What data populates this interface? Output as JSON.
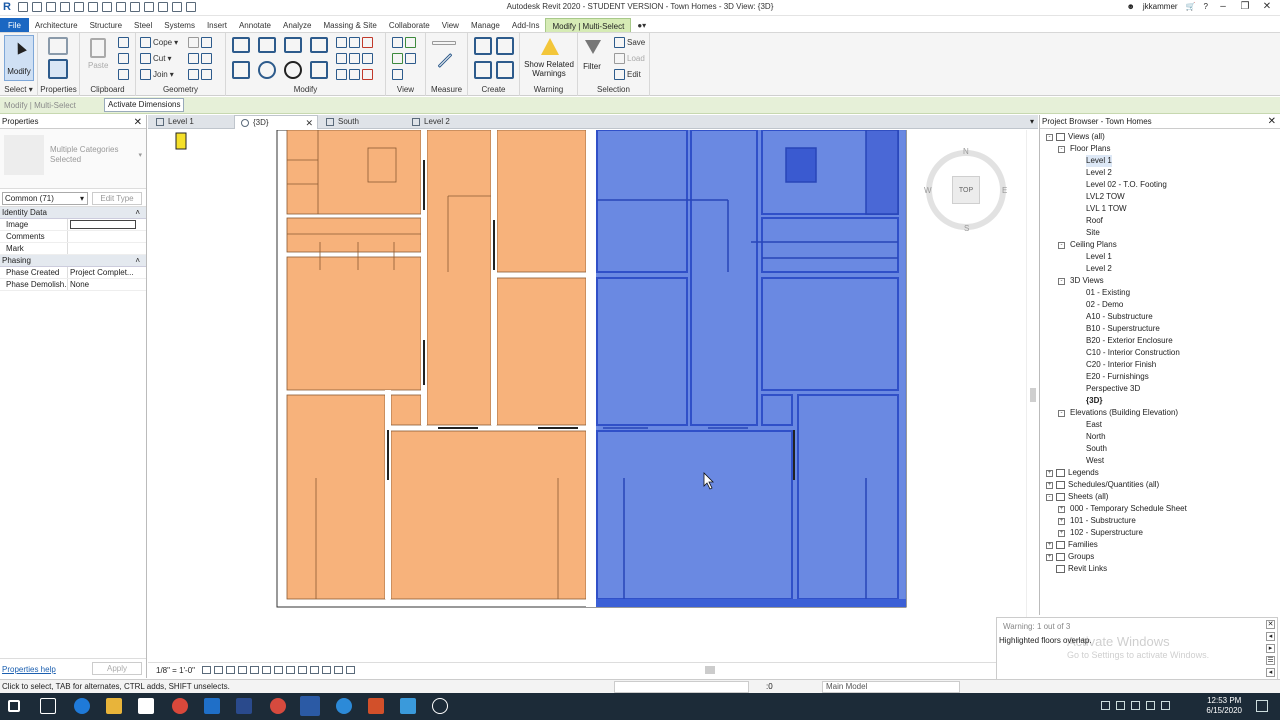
{
  "window": {
    "title": "Autodesk Revit 2020 - STUDENT VERSION - Town Homes - 3D View: {3D}",
    "user": "jkkammer"
  },
  "ribbon_tabs": [
    "File",
    "Architecture",
    "Structure",
    "Steel",
    "Systems",
    "Insert",
    "Annotate",
    "Analyze",
    "Massing & Site",
    "Collaborate",
    "View",
    "Manage",
    "Add-Ins",
    "Modify | Multi-Select"
  ],
  "ribbon": {
    "modify": "Modify",
    "select": "Select",
    "properties": "Properties",
    "paste": "Paste",
    "clipboard": "Clipboard",
    "cope": "Cope",
    "cut": "Cut",
    "join": "Join",
    "geometry": "Geometry",
    "modify_panel": "Modify",
    "view": "View",
    "measure": "Measure",
    "create": "Create",
    "show_related_warnings": "Show Related Warnings",
    "warning": "Warning",
    "filter": "Filter",
    "save": "Save",
    "load": "Load",
    "edit": "Edit",
    "selection": "Selection"
  },
  "context_bar": {
    "label": "Modify | Multi-Select",
    "activate_dimensions": "Activate Dimensions"
  },
  "properties": {
    "header": "Properties",
    "type_name": "Multiple Categories Selected",
    "category_filter": "Common (71)",
    "edit_type": "Edit Type",
    "groups": [
      {
        "name": "Identity Data",
        "rows": [
          {
            "key": "Image",
            "value": ""
          },
          {
            "key": "Comments",
            "value": ""
          },
          {
            "key": "Mark",
            "value": ""
          }
        ]
      },
      {
        "name": "Phasing",
        "rows": [
          {
            "key": "Phase Created",
            "value": "Project Complet..."
          },
          {
            "key": "Phase Demolish...",
            "value": "None"
          }
        ]
      }
    ],
    "help_link": "Properties help",
    "apply": "Apply"
  },
  "view_tabs": [
    {
      "label": "Level 1",
      "active": false
    },
    {
      "label": "{3D}",
      "active": true
    },
    {
      "label": "South",
      "active": false
    },
    {
      "label": "Level 2",
      "active": false
    }
  ],
  "viewcube": {
    "top": "TOP",
    "n": "N",
    "s": "S",
    "w": "W",
    "e": "E"
  },
  "view_control": {
    "scale": "1/8\" = 1'-0\""
  },
  "project_browser": {
    "header": "Project Browser - Town Homes",
    "tree": [
      {
        "label": "Views (all)",
        "level": 0,
        "toggle": "-",
        "icon": true
      },
      {
        "label": "Floor Plans",
        "level": 1,
        "toggle": "-"
      },
      {
        "label": "Level 1",
        "level": 2,
        "selected": true
      },
      {
        "label": "Level 2",
        "level": 2
      },
      {
        "label": "Level 02 - T.O. Footing",
        "level": 2
      },
      {
        "label": "LVL2 TOW",
        "level": 2
      },
      {
        "label": "LVL 1 TOW",
        "level": 2
      },
      {
        "label": "Roof",
        "level": 2
      },
      {
        "label": "Site",
        "level": 2
      },
      {
        "label": "Ceiling Plans",
        "level": 1,
        "toggle": "-"
      },
      {
        "label": "Level 1",
        "level": 2
      },
      {
        "label": "Level 2",
        "level": 2
      },
      {
        "label": "3D Views",
        "level": 1,
        "toggle": "-"
      },
      {
        "label": "01 - Existing",
        "level": 2
      },
      {
        "label": "02 - Demo",
        "level": 2
      },
      {
        "label": "A10 - Substructure",
        "level": 2
      },
      {
        "label": "B10 - Superstructure",
        "level": 2
      },
      {
        "label": "B20 - Exterior Enclosure",
        "level": 2
      },
      {
        "label": "C10 - Interior Construction",
        "level": 2
      },
      {
        "label": "C20 - Interior Finish",
        "level": 2
      },
      {
        "label": "E20 - Furnishings",
        "level": 2
      },
      {
        "label": "Perspective 3D",
        "level": 2
      },
      {
        "label": "{3D}",
        "level": 2,
        "bold": true
      },
      {
        "label": "Elevations (Building Elevation)",
        "level": 1,
        "toggle": "-"
      },
      {
        "label": "East",
        "level": 2
      },
      {
        "label": "North",
        "level": 2
      },
      {
        "label": "South",
        "level": 2
      },
      {
        "label": "West",
        "level": 2
      },
      {
        "label": "Legends",
        "level": 0,
        "toggle": "+",
        "icon": true
      },
      {
        "label": "Schedules/Quantities (all)",
        "level": 0,
        "toggle": "+",
        "icon": true
      },
      {
        "label": "Sheets (all)",
        "level": 0,
        "toggle": "-",
        "icon": true
      },
      {
        "label": "000 - Temporary Schedule Sheet",
        "level": 1,
        "toggle": "+"
      },
      {
        "label": "101 - Substructure",
        "level": 1,
        "toggle": "+"
      },
      {
        "label": "102 - Superstructure",
        "level": 1,
        "toggle": "+"
      },
      {
        "label": "Families",
        "level": 0,
        "toggle": "+",
        "icon": true
      },
      {
        "label": "Groups",
        "level": 0,
        "toggle": "+",
        "icon": true
      },
      {
        "label": "Revit Links",
        "level": 0,
        "icon": true
      }
    ]
  },
  "warning": {
    "counter": "Warning: 1 out of 3",
    "message": "Highlighted floors overlap.",
    "activate_title": "Activate Windows",
    "activate_sub": "Go to Settings to activate Windows."
  },
  "status_bar": {
    "message": "Click to select, TAB for alternates, CTRL adds, SHIFT unselects.",
    "count": ":0",
    "model": "Main Model"
  },
  "taskbar": {
    "time": "12:53 PM",
    "date": "6/15/2020"
  },
  "colors": {
    "floor_orange": "#f7b27b",
    "floor_blue": "#5d7fe0",
    "floor_blue_dark": "#3b5fd6",
    "accent": "#1b67c2",
    "context_green": "#d6ebb5"
  }
}
